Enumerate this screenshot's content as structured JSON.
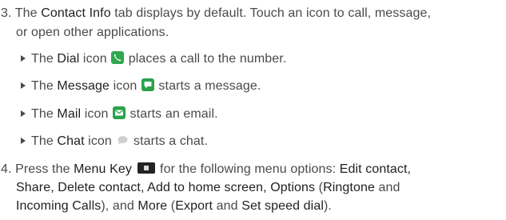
{
  "step3": {
    "num": "3.",
    "pre": "The ",
    "tab": "Contact Info",
    "post1": " tab displays by default. Touch an icon to call, message,",
    "post2": "or open other applications."
  },
  "bullets": [
    {
      "pre": "The ",
      "name": "Dial",
      "mid": " icon ",
      "post": " places a call to the number.",
      "icon": "phone-icon"
    },
    {
      "pre": "The ",
      "name": "Message",
      "mid": " icon ",
      "post": " starts a message.",
      "icon": "message-icon"
    },
    {
      "pre": "The ",
      "name": "Mail",
      "mid": " icon ",
      "post": " starts an email.",
      "icon": "mail-icon"
    },
    {
      "pre": "The ",
      "name": "Chat",
      "mid": " icon ",
      "post": " starts a chat.",
      "icon": "chat-icon"
    }
  ],
  "step4": {
    "num": "4.",
    "pre": "Press the ",
    "key": "Menu Key",
    "mid": " for the following menu options: ",
    "opt1": "Edit contact,",
    "l2a": "Share, Delete contact, Add to home screen, Options",
    "l2b": " (",
    "ring": "Ringtone",
    "l2c": " and",
    "l3a": "Incoming Calls",
    "l3b": "), and ",
    "more": "More",
    "l3c": " (",
    "exp": "Export",
    "l3d": " and ",
    "speed": "Set speed dial",
    "l3e": ")."
  }
}
